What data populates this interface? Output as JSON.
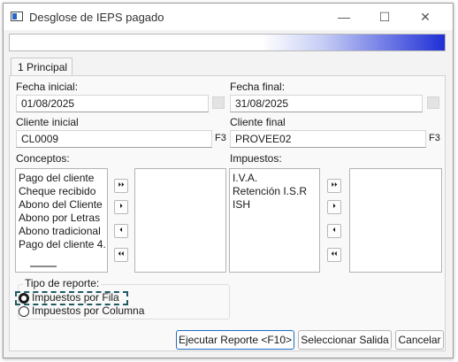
{
  "window": {
    "title": "Desglose de IEPS pagado",
    "minimize_glyph": "—",
    "maximize_glyph": "☐",
    "close_glyph": "✕"
  },
  "tabs": [
    {
      "label": "1 Principal"
    }
  ],
  "form": {
    "fecha_inicial": {
      "label": "Fecha inicial:",
      "value": "01/08/2025"
    },
    "fecha_final": {
      "label": "Fecha final:",
      "value": "31/08/2025"
    },
    "cliente_inicial": {
      "label": "Cliente inicial",
      "value": "CL0009",
      "key": "F3"
    },
    "cliente_final": {
      "label": "Cliente final",
      "value": "PROVEE02",
      "key": "F3"
    },
    "conceptos": {
      "label": "Conceptos:",
      "available": [
        "Pago del cliente",
        "Cheque recibido",
        "Abono del Cliente",
        "Abono por Letras",
        "Abono tradicional",
        "Pago del cliente 4."
      ],
      "selected": []
    },
    "impuestos": {
      "label": "Impuestos:",
      "available": [
        "I.V.A.",
        "Retención I.S.R",
        "ISH"
      ],
      "selected": []
    },
    "arrows": {
      "move_all_right": "⏵⏵",
      "move_right": "⏵",
      "move_left": "⏴",
      "move_all_left": "⏴⏴"
    },
    "tipo_reporte": {
      "label": "Tipo de reporte:",
      "options": [
        {
          "label": "Impuestos por Fila",
          "selected": true
        },
        {
          "label": "Impuestos por Columna",
          "selected": false
        }
      ]
    }
  },
  "buttons": {
    "ejecutar": "Ejecutar Reporte <F10>",
    "seleccionar": "Seleccionar Salida",
    "cancelar": "Cancelar"
  }
}
